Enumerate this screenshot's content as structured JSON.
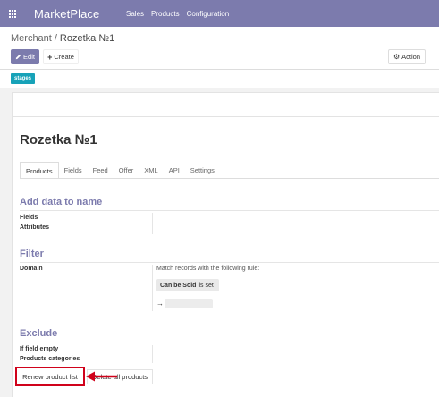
{
  "topbar": {
    "brand": "MarketPlace",
    "menu": [
      "Sales",
      "Products",
      "Configuration"
    ],
    "bg_color": "#7c7bad"
  },
  "breadcrumb": {
    "parent": "Merchant",
    "separator": "/",
    "current": "Rozetka №1"
  },
  "toolbar": {
    "edit_label": "Edit",
    "create_label": "Create",
    "action_label": "Action"
  },
  "stages_badge": "stages",
  "record": {
    "title": "Rozetka №1",
    "tabs": [
      "Products",
      "Fields",
      "Feed",
      "Offer",
      "XML",
      "API",
      "Settings"
    ],
    "active_tab": "Products"
  },
  "sections": {
    "add_data": {
      "heading": "Add data to name",
      "fields": [
        "Fields",
        "Attributes"
      ]
    },
    "filter": {
      "heading": "Filter",
      "domain_label": "Domain",
      "match_text": "Match records with the following rule:",
      "facet_field": "Can be Sold",
      "facet_op": "is set"
    },
    "exclude": {
      "heading": "Exclude",
      "fields": [
        "If field empty",
        "Products categories"
      ]
    }
  },
  "footer_buttons": {
    "renew": "Renew product list",
    "delete": "Delete all products"
  },
  "colors": {
    "accent": "#7c7bad",
    "stages": "#17a2b8",
    "highlight": "#d0021b"
  }
}
